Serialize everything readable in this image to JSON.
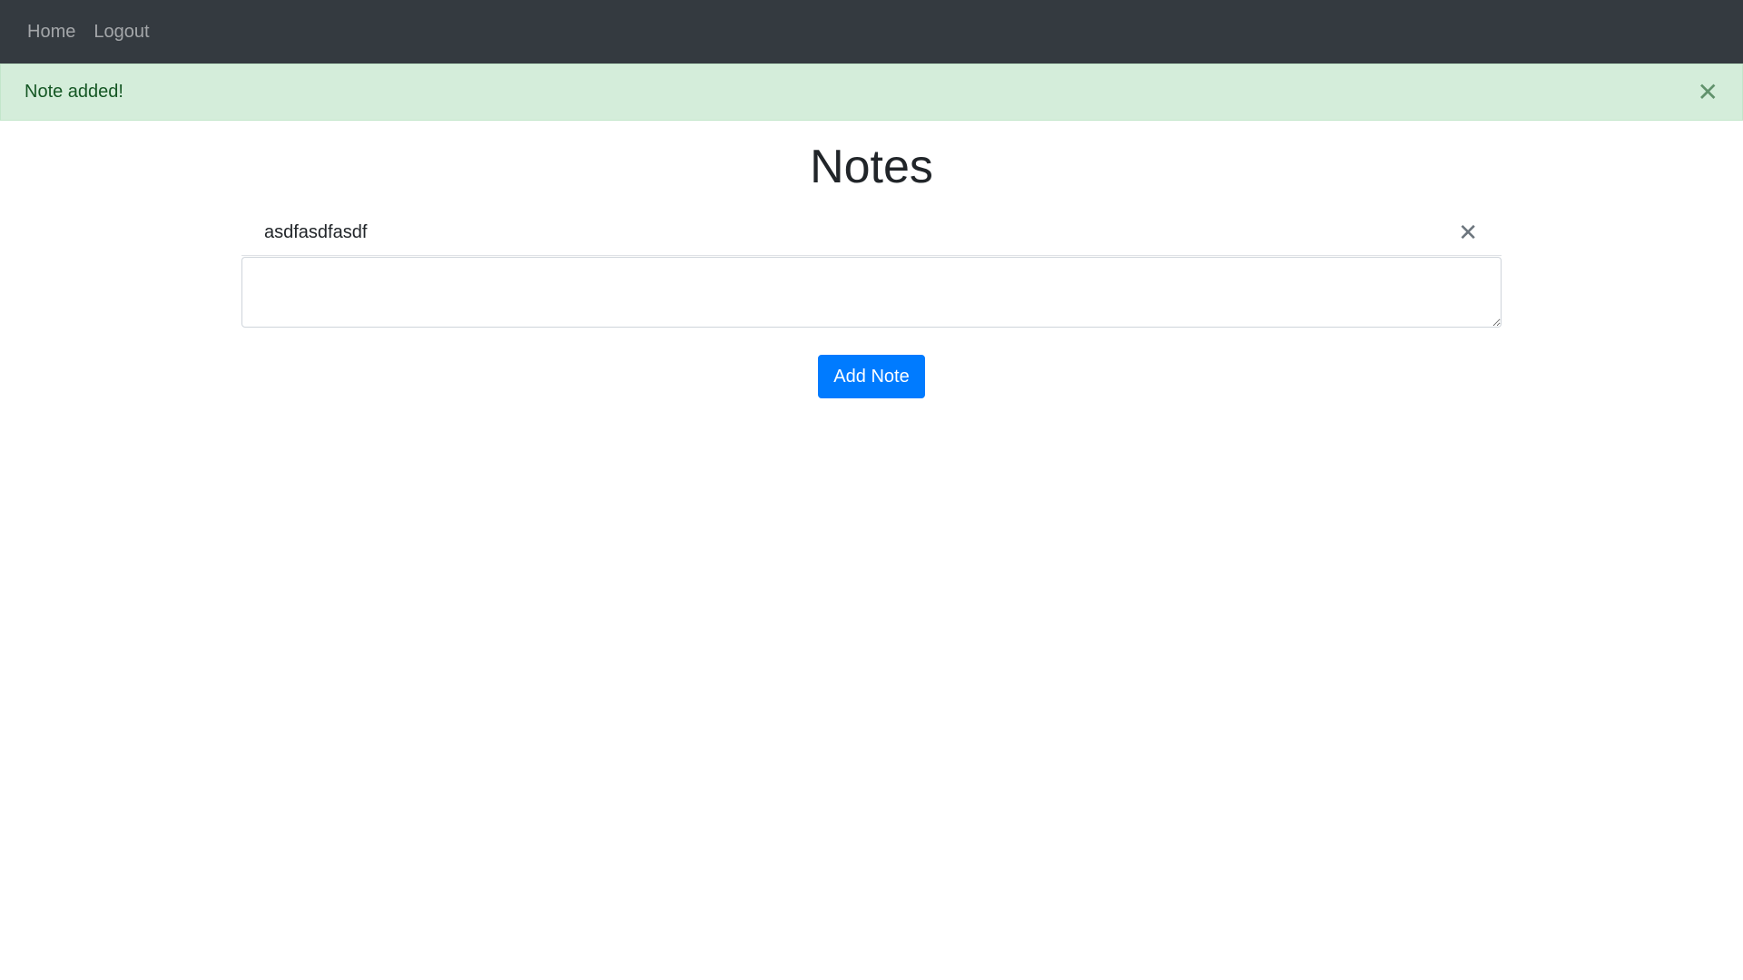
{
  "nav": {
    "home_label": "Home",
    "logout_label": "Logout"
  },
  "alert": {
    "message": "Note added!",
    "close_icon": "close-icon",
    "close_glyph": "✕"
  },
  "page": {
    "title": "Notes"
  },
  "notes": [
    {
      "text": "asdfasdfasdf",
      "delete_glyph": "✕"
    }
  ],
  "form": {
    "textarea_value": "",
    "add_button_label": "Add Note"
  },
  "colors": {
    "navbar": "#343a40",
    "alert_bg": "#d4edda",
    "alert_text": "#155724",
    "primary": "#007bff"
  }
}
